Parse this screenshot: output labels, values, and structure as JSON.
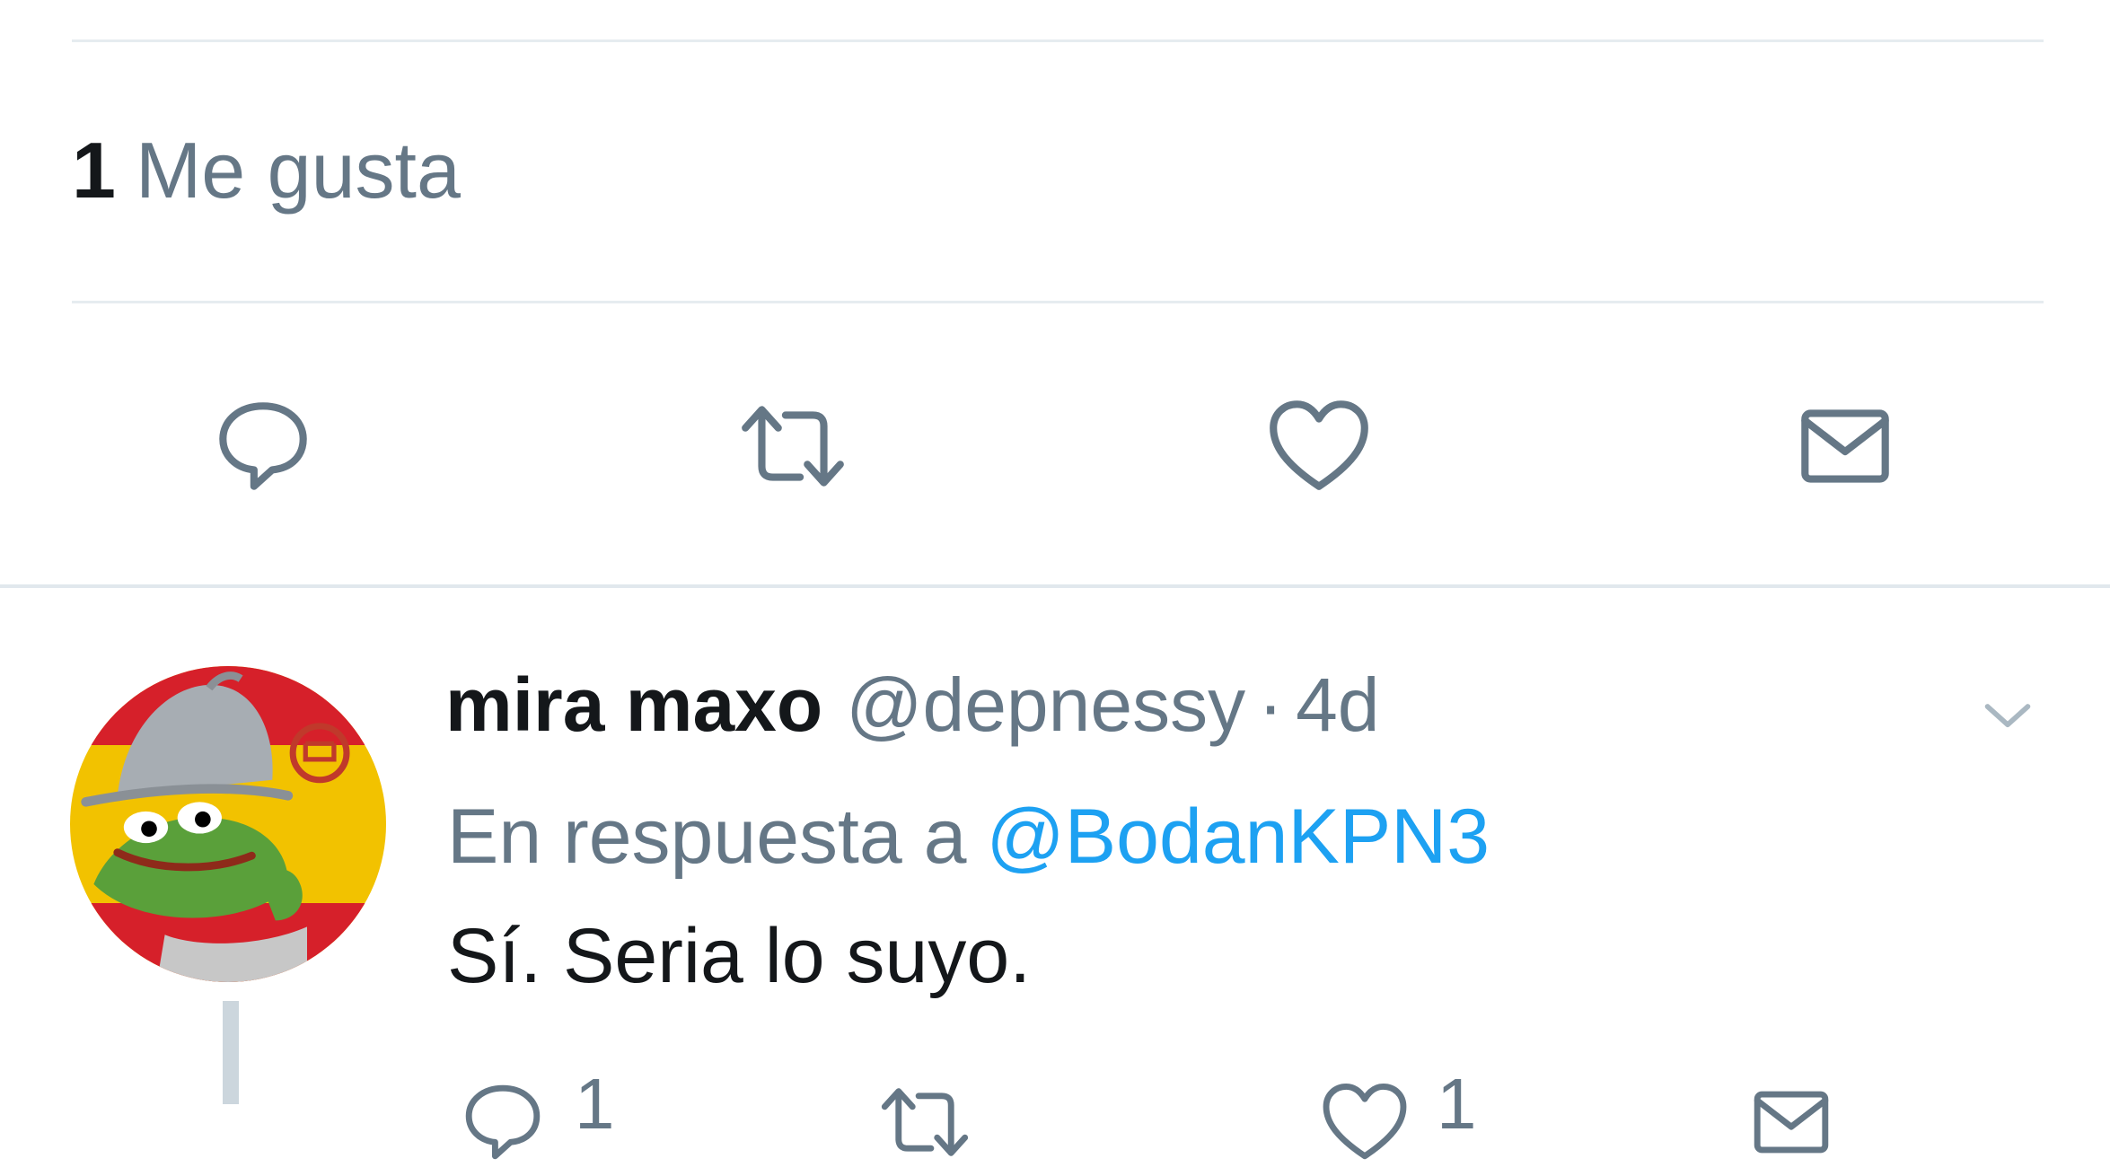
{
  "stats": {
    "likes_count": "1",
    "likes_label": "Me gusta"
  },
  "actions": [
    {
      "name": "reply",
      "icon": "reply-icon"
    },
    {
      "name": "retweet",
      "icon": "retweet-icon"
    },
    {
      "name": "like",
      "icon": "heart-icon"
    },
    {
      "name": "direct-message",
      "icon": "envelope-icon"
    }
  ],
  "reply_tweet": {
    "author_name": "mira maxo",
    "author_handle": "@depnessy",
    "separator": "·",
    "time": "4d",
    "reply_prefix": "En respuesta a",
    "reply_handle": "@BodanKPN3",
    "text": "Sí. Seria lo suyo.",
    "reply_count": "1",
    "like_count": "1"
  },
  "colors": {
    "text_primary": "#14171a",
    "text_secondary": "#657786",
    "link": "#1da1f2",
    "icon": "#657786",
    "divider": "#e6ecf0"
  }
}
